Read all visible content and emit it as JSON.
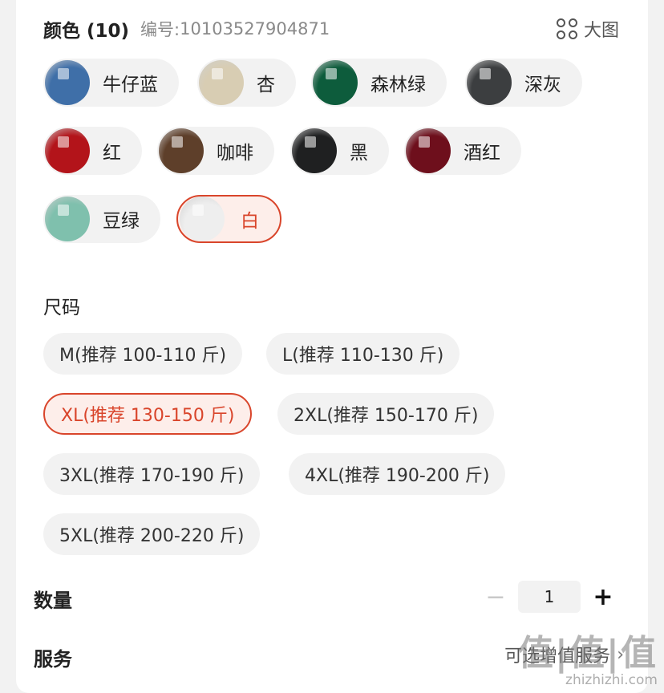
{
  "color": {
    "title": "颜色 (10)",
    "sku_label": "编号:",
    "sku_value": "10103527904871",
    "bigview_label": "大图",
    "options": [
      {
        "label": "牛仔蓝",
        "swatch": "#3f6fa8"
      },
      {
        "label": "杏",
        "swatch": "#d8cdb3"
      },
      {
        "label": "森林绿",
        "swatch": "#0d5c3c"
      },
      {
        "label": "深灰",
        "swatch": "#3c3e40"
      },
      {
        "label": "红",
        "swatch": "#b3141a"
      },
      {
        "label": "咖啡",
        "swatch": "#5e3f2a"
      },
      {
        "label": "黑",
        "swatch": "#1f2021"
      },
      {
        "label": "酒红",
        "swatch": "#6e0f1c"
      },
      {
        "label": "豆绿",
        "swatch": "#7fc0ad"
      },
      {
        "label": "白",
        "swatch": "#eeeeee",
        "selected": true
      }
    ]
  },
  "size": {
    "title": "尺码",
    "options": [
      {
        "label": "M(推荐 100-110 斤)"
      },
      {
        "label": "L(推荐 110-130 斤)"
      },
      {
        "label": "XL(推荐 130-150 斤)",
        "selected": true
      },
      {
        "label": "2XL(推荐 150-170 斤)"
      },
      {
        "label": "3XL(推荐 170-190 斤)"
      },
      {
        "label": "4XL(推荐 190-200 斤)"
      },
      {
        "label": "5XL(推荐 200-220 斤)"
      }
    ]
  },
  "quantity": {
    "label": "数量",
    "minus": "−",
    "value": "1",
    "plus": "+"
  },
  "service": {
    "label": "服务",
    "value": "可选增值服务",
    "chevron": "›"
  },
  "watermark": {
    "big": "值|值|值",
    "small": "zhizhizhi.com"
  },
  "colors": {
    "accent": "#d9452b",
    "accent_bg": "#fdeeea",
    "chip_bg": "#f2f2f2"
  }
}
